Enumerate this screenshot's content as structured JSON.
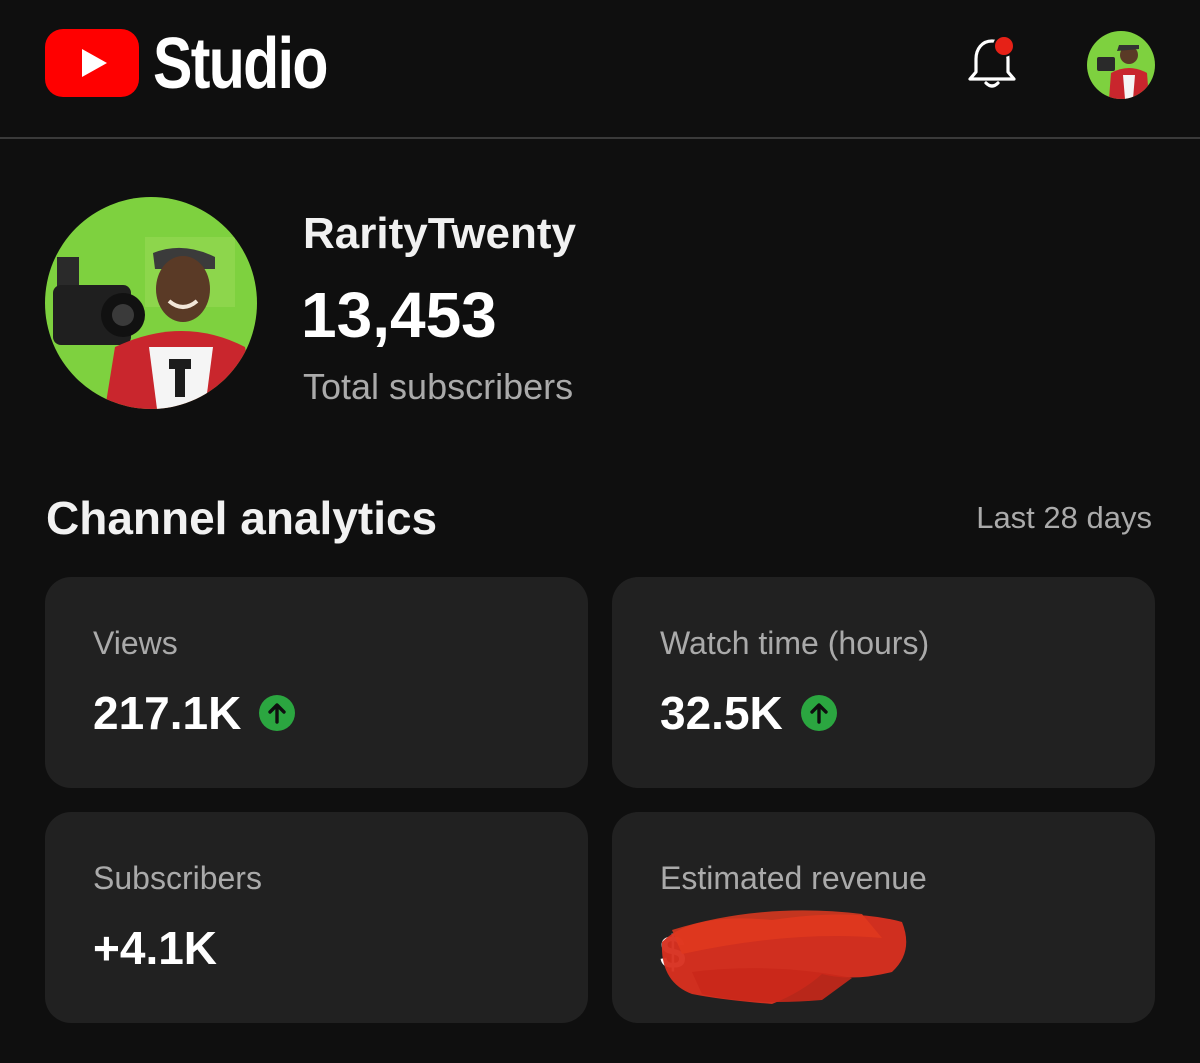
{
  "app": {
    "title": "Studio"
  },
  "header": {
    "logo_icon": "youtube-play-icon",
    "notifications_icon": "bell-icon",
    "notification_dot_color": "#e62117",
    "brand_color": "#ff0000"
  },
  "channel": {
    "name": "RarityTwenty",
    "subscriber_count": "13,453",
    "subscriber_label": "Total subscribers"
  },
  "analytics": {
    "title": "Channel analytics",
    "period": "Last 28 days",
    "trend_up_color": "#2ba640",
    "cards": [
      {
        "label": "Views",
        "value": "217.1K",
        "trend_icon": "arrow-up-circle-icon"
      },
      {
        "label": "Watch time (hours)",
        "value": "32.5K",
        "trend_icon": "arrow-up-circle-icon"
      },
      {
        "label": "Subscribers",
        "value": "+4.1K"
      },
      {
        "label": "Estimated revenue",
        "value": "$"
      }
    ]
  }
}
